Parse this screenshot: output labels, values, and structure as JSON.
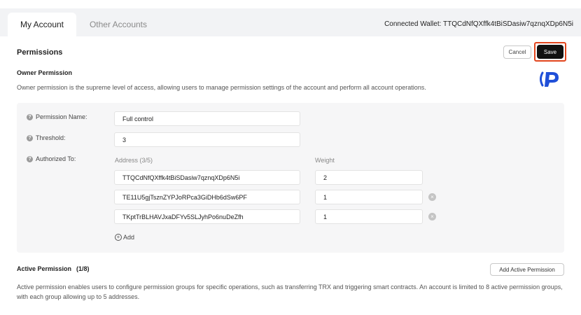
{
  "tabs": [
    {
      "label": "My Account",
      "active": true
    },
    {
      "label": "Other Accounts",
      "active": false
    }
  ],
  "wallet": {
    "label": "Connected Wallet: TTQCdNfQXffk4tBiSDasiw7qznqXDp6N5i"
  },
  "header": {
    "title": "Permissions",
    "cancel_label": "Cancel",
    "save_label": "Save"
  },
  "owner": {
    "title": "Owner Permission",
    "description": "Owner permission is the supreme level of access, allowing users to manage permission settings of the account and perform all account operations.",
    "fields": {
      "name_label": "Permission Name:",
      "name_value": "Full control",
      "threshold_label": "Threshold:",
      "threshold_value": "3",
      "authorized_label": "Authorized To:"
    },
    "address_header": "Address (3/5)",
    "weight_header": "Weight",
    "rows": [
      {
        "address": "TTQCdNfQXffk4tBiSDasiw7qznqXDp6N5i",
        "weight": "2"
      },
      {
        "address": "TE11U5gjTsznZYPJoRPca3GiDHb6dSw6PF",
        "weight": "1"
      },
      {
        "address": "TKptTrBLHAVJxaDFYv5SLJyhPo6nuDeZfh",
        "weight": "1"
      }
    ],
    "add_label": "Add"
  },
  "active": {
    "title": "Active Permission",
    "count": "(1/8)",
    "add_button_label": "Add Active Permission",
    "description": "Active permission enables users to configure permission groups for specific operations, such as transferring TRX and triggering smart contracts. An account is limited to 8 active permission groups, with each group allowing up to 5 addresses."
  },
  "colors": {
    "save_highlight": "#e2461e",
    "logo_blue": "#1f4fd8",
    "panel_bg": "#f6f6f7"
  }
}
